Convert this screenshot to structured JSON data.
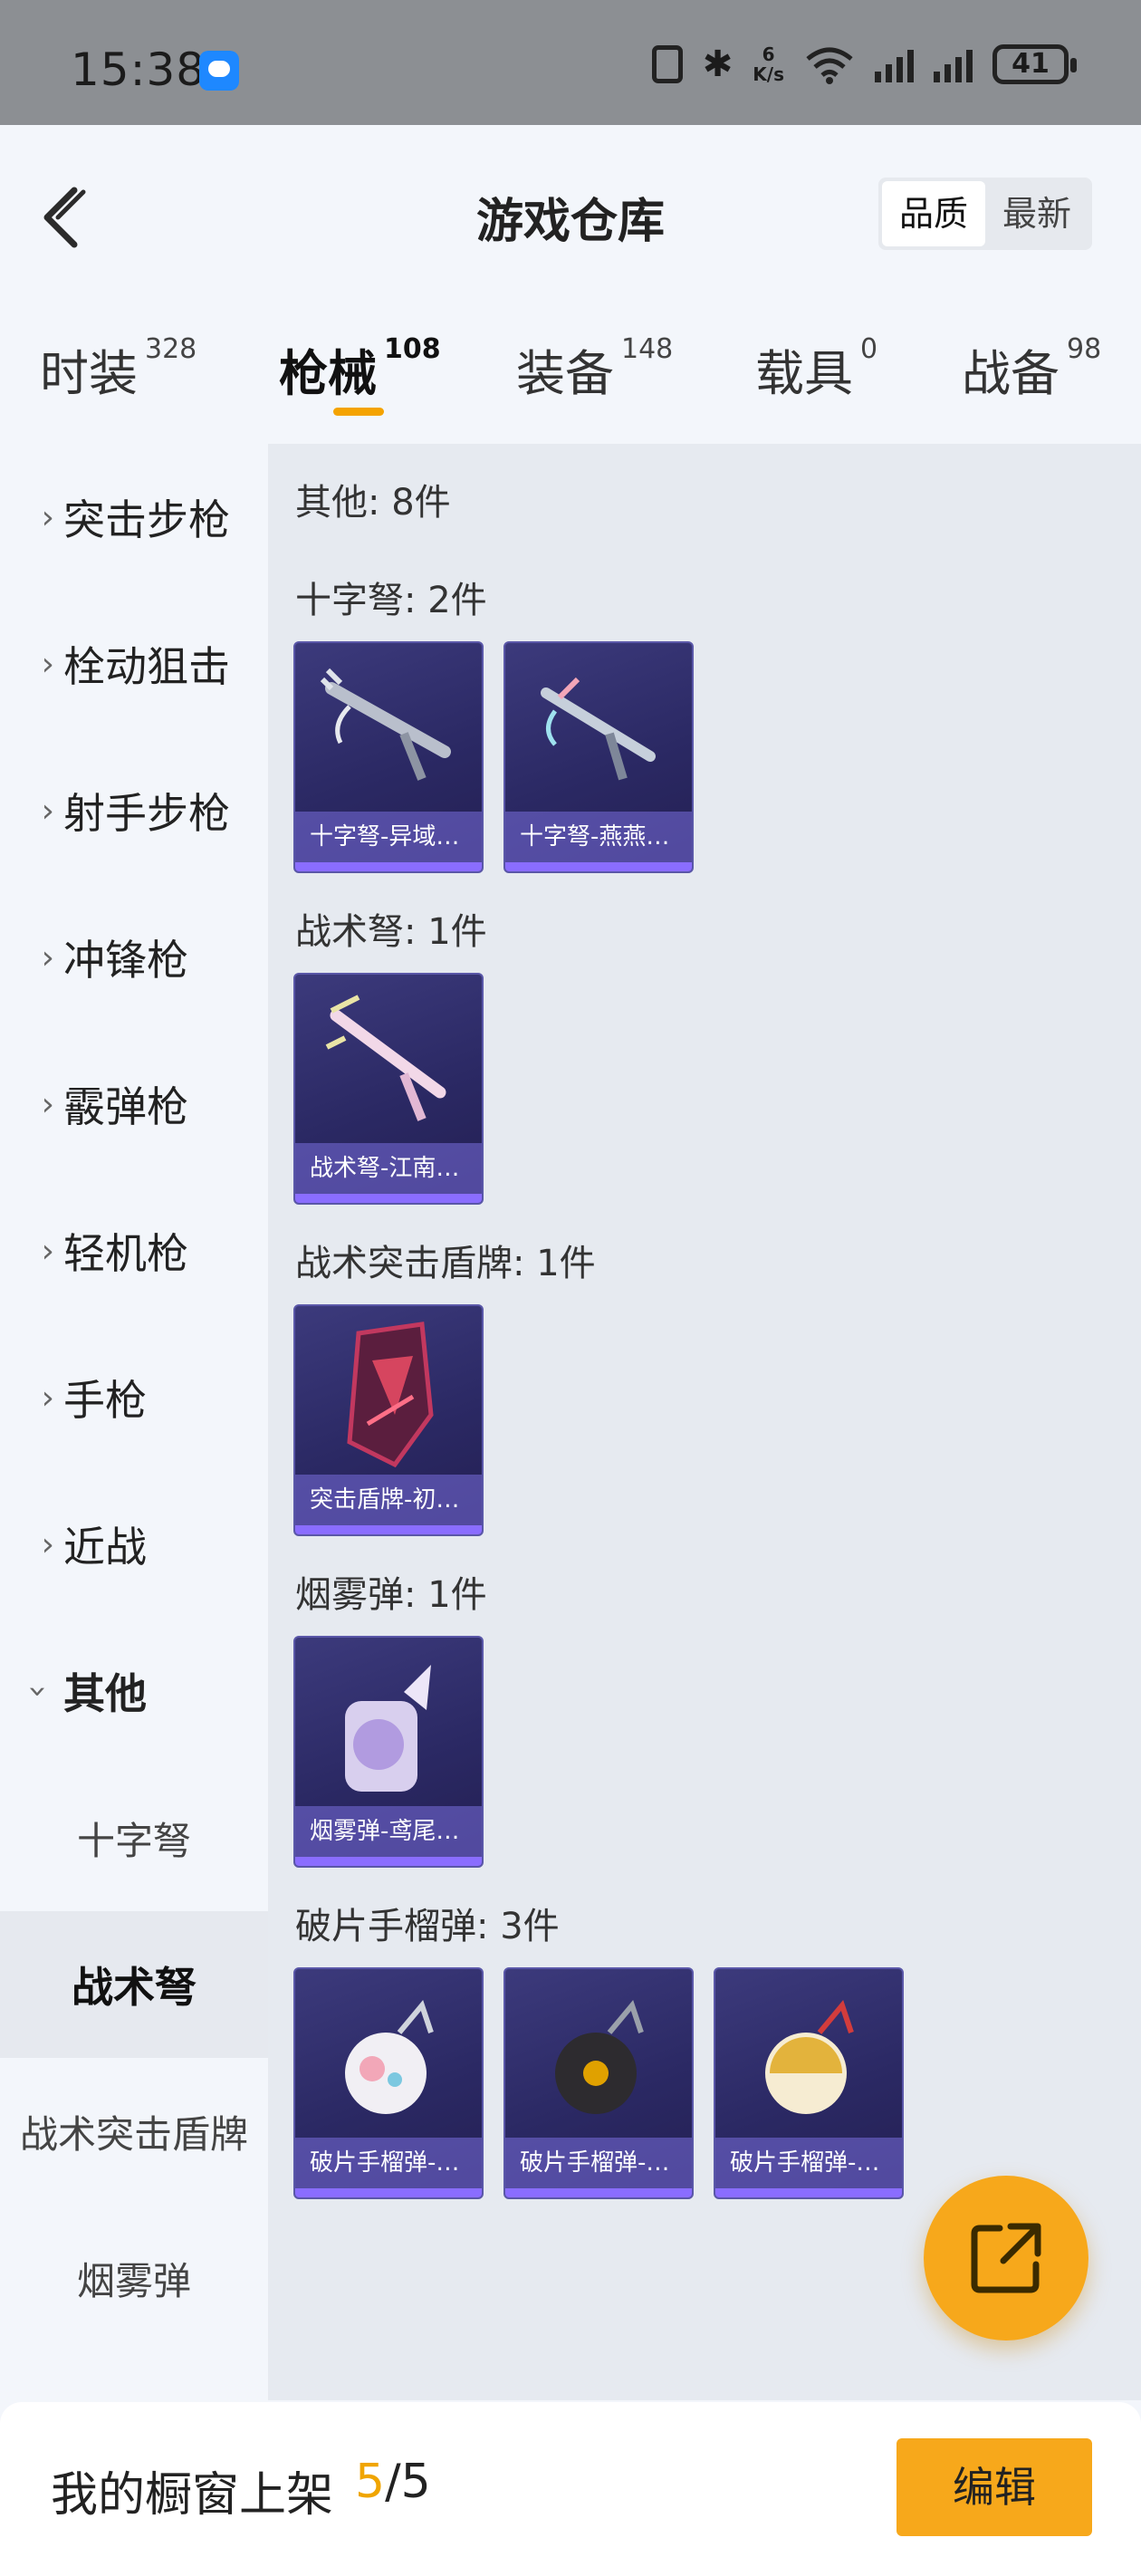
{
  "status_bar": {
    "time": "15:38",
    "speed_value": "6",
    "speed_unit": "K/s",
    "battery": "41"
  },
  "header": {
    "title": "游戏仓库",
    "sort_options": [
      "品质",
      "最新"
    ],
    "sort_active": "品质"
  },
  "category_tabs": [
    {
      "label": "时装",
      "count": "328"
    },
    {
      "label": "枪械",
      "count": "108"
    },
    {
      "label": "装备",
      "count": "148"
    },
    {
      "label": "载具",
      "count": "0"
    },
    {
      "label": "战备",
      "count": "98"
    }
  ],
  "active_category": "枪械",
  "sidebar": {
    "items": [
      "突击步枪",
      "栓动狙击",
      "射手步枪",
      "冲锋枪",
      "霰弹枪",
      "轻机枪",
      "手枪",
      "近战",
      "其他"
    ],
    "expanded": "其他",
    "sub_items": [
      "十字弩",
      "战术弩",
      "战术突击盾牌",
      "烟雾弹"
    ],
    "active_sub": "战术弩"
  },
  "content": {
    "summary": "其他: 8件",
    "groups": [
      {
        "title": "十字弩: 2件",
        "items": [
          "十字弩-异域…",
          "十字弩-燕燕…"
        ]
      },
      {
        "title": "战术弩: 1件",
        "items": [
          "战术弩-江南…"
        ]
      },
      {
        "title": "战术突击盾牌: 1件",
        "items": [
          "突击盾牌-初…"
        ]
      },
      {
        "title": "烟雾弹: 1件",
        "items": [
          "烟雾弹-鸢尾…"
        ]
      },
      {
        "title": "破片手榴弹: 3件",
        "items": [
          "破片手榴弹-…",
          "破片手榴弹-…",
          "破片手榴弹-…"
        ]
      }
    ]
  },
  "bottom_bar": {
    "label": "我的橱窗上架",
    "current": "5",
    "separator": "/",
    "total": "5",
    "edit_label": "编辑"
  },
  "colors": {
    "accent": "#f7a81b",
    "card_bg": "#2b2964",
    "card_border": "#5a57a8"
  },
  "icons": {
    "back": "chevron-left-icon",
    "fab": "share-external-icon"
  }
}
